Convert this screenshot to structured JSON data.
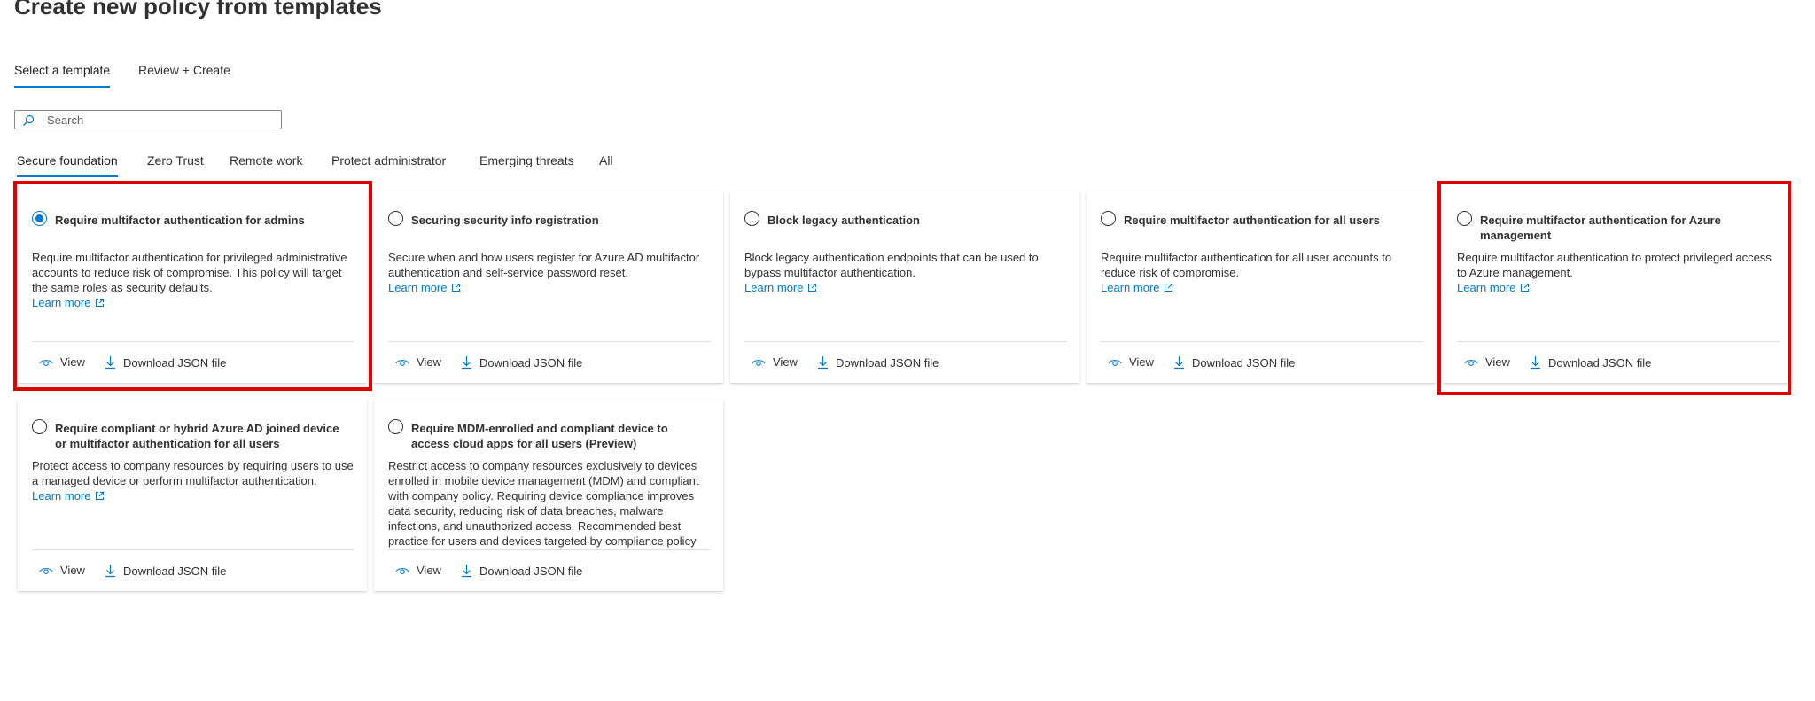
{
  "page": {
    "title": "Create new policy from templates",
    "more_icon": "ellipsis-icon",
    "more_label": "···"
  },
  "wizard_steps": [
    {
      "label": "Select a template",
      "active": true
    },
    {
      "label": "Review + Create",
      "active": false
    }
  ],
  "search": {
    "placeholder": "Search",
    "value": "",
    "icon": "search-icon"
  },
  "category_tabs": [
    {
      "label": "Secure foundation",
      "active": true
    },
    {
      "label": "Zero Trust",
      "active": false
    },
    {
      "label": "Remote work",
      "active": false
    },
    {
      "label": "Protect administrator",
      "active": false
    },
    {
      "label": "Emerging threats",
      "active": false
    },
    {
      "label": "All",
      "active": false
    }
  ],
  "templates": [
    {
      "title": "Require multifactor authentication for admins",
      "description": "Require multifactor authentication for privileged administrative accounts to reduce risk of compromise. This policy will target the same roles as security defaults.",
      "learn_more": "Learn more",
      "selected": true,
      "highlighted": true
    },
    {
      "title": "Securing security info registration",
      "description": "Secure when and how users register for Azure AD multifactor authentication and self-service password reset.",
      "learn_more": "Learn more",
      "selected": false,
      "highlighted": false
    },
    {
      "title": "Block legacy authentication",
      "description": "Block legacy authentication endpoints that can be used to bypass multifactor authentication.",
      "learn_more": "Learn more",
      "selected": false,
      "highlighted": false
    },
    {
      "title": "Require multifactor authentication for all users",
      "description": "Require multifactor authentication for all user accounts to reduce risk of compromise.",
      "learn_more": "Learn more",
      "selected": false,
      "highlighted": false
    },
    {
      "title": "Require multifactor authentication for Azure management",
      "description": "Require multifactor authentication to protect privileged access to Azure management.",
      "learn_more": "Learn more",
      "selected": false,
      "highlighted": true
    },
    {
      "title": "Require compliant or hybrid Azure AD joined device or multifactor authentication for all users",
      "description": "Protect access to company resources by requiring users to use a managed device or perform multifactor authentication.",
      "learn_more": "Learn more",
      "selected": false,
      "highlighted": false
    },
    {
      "title": "Require MDM-enrolled and compliant device to access cloud apps for all users (Preview)",
      "description": "Restrict access to company resources exclusively to devices enrolled in mobile device management (MDM) and compliant with company policy. Requiring device compliance improves data security, reducing risk of data breaches, malware infections, and unauthorized access. Recommended best practice for users and devices targeted by compliance policy",
      "learn_more": "",
      "selected": false,
      "highlighted": false
    }
  ],
  "card_actions": {
    "view_label": "View",
    "download_label": "Download JSON file"
  },
  "colors": {
    "accent": "#0078d4",
    "highlight": "#e00000",
    "text": "#323130"
  }
}
